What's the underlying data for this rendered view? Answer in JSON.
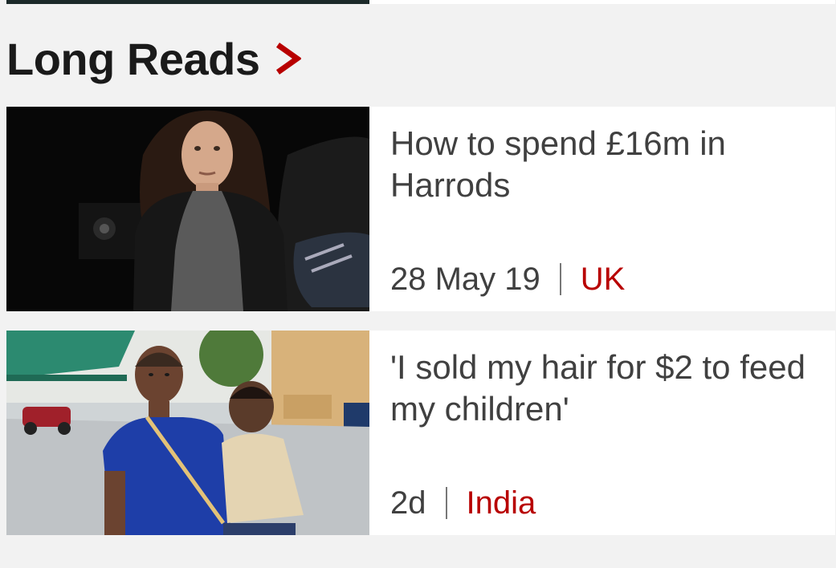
{
  "section": {
    "title": "Long Reads",
    "chevron_icon": "chevron-right-icon",
    "accent_color": "#b80000"
  },
  "stories": [
    {
      "headline": "How to spend £16m in Harrods",
      "time": "28 May 19",
      "topic": "UK",
      "image_icon": "photo-woman-night"
    },
    {
      "headline": "'I sold my hair for $2 to feed my children'",
      "time": "2d",
      "topic": "India",
      "image_icon": "photo-woman-child-street"
    }
  ]
}
